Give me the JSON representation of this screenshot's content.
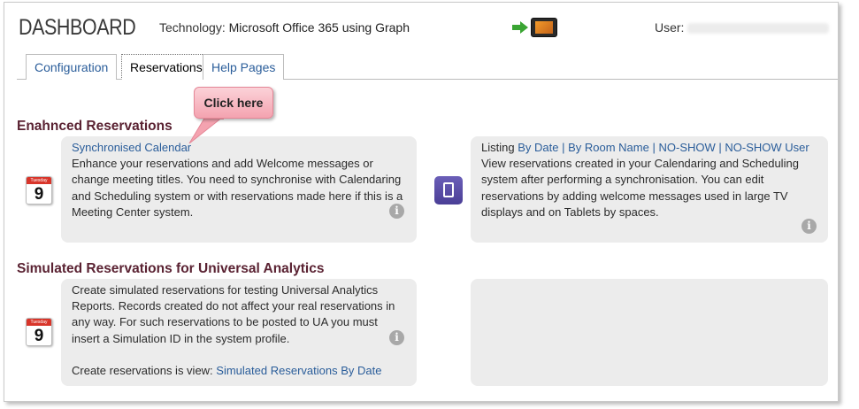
{
  "header": {
    "title": "DASHBOARD",
    "tech_label": "Technology:",
    "tech_value": "Microsoft Office 365 using Graph",
    "user_label": "User:"
  },
  "tabs": [
    {
      "label": "Configuration",
      "active": false
    },
    {
      "label": "Reservations",
      "active": true
    },
    {
      "label": "Help Pages",
      "active": false
    }
  ],
  "callout": "Click here",
  "sections": {
    "enhanced": {
      "title": "Enahnced Reservations",
      "left_card": {
        "link": "Synchronised Calendar",
        "text": "Enhance your reservations and add Welcome messages or change meeting titles. You need to synchronise with Calendaring and Scheduling system or with reservations made here if this is a Meeting Center system.",
        "calendar_day": "9",
        "calendar_month": "Tuesday"
      },
      "right_card": {
        "listing_label": "Listing",
        "links": [
          "By Date",
          "By Room Name",
          "NO-SHOW",
          "NO-SHOW User"
        ],
        "separator": "|",
        "text": "View reservations created in your Calendaring and Scheduling system after performing a synchronisation.  You can edit reservations by adding welcome messages used in large TV displays and on Tablets by spaces."
      }
    },
    "simulated": {
      "title": "Simulated Reservations for Universal Analytics",
      "left_card": {
        "text": "Create simulated reservations for testing Universal Analytics Reports. Records created do not affect your real reservations in any way. For such reservations to be posted to UA you must insert a Simulation ID in the system profile.",
        "view_label": "Create reservations is view:",
        "view_link": "Simulated Reservations By Date",
        "calendar_day": "9",
        "calendar_month": "Tuesday"
      }
    }
  },
  "info_glyph": "i",
  "colors": {
    "section_title": "#5a2232",
    "link": "#2a5d9a",
    "card_bg": "#ececec",
    "callout": "#f4a3b0"
  }
}
